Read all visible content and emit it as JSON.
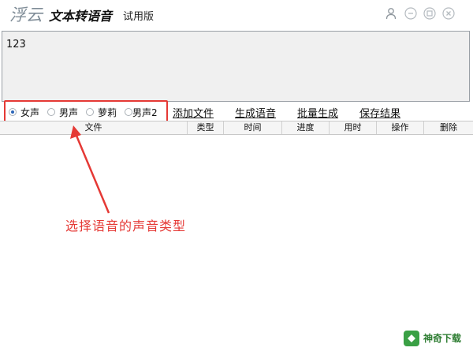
{
  "app": {
    "name": "浮云",
    "subtitle": "文本转语音",
    "edition": "试用版"
  },
  "titlebar": {
    "buttons": [
      {
        "icon": "user-icon"
      },
      {
        "icon": "minimize-icon"
      },
      {
        "icon": "restore-icon"
      },
      {
        "icon": "close-icon"
      }
    ]
  },
  "editor": {
    "text": "123"
  },
  "voice": {
    "options": [
      "女声",
      "男声",
      "萝莉",
      "男声2"
    ],
    "selected": "女声"
  },
  "actions": {
    "add_file": "添加文件",
    "generate": "生成语音",
    "batch": "批量生成",
    "save": "保存结果"
  },
  "table": {
    "headers": [
      "文件",
      "类型",
      "时间",
      "进度",
      "用时",
      "操作",
      "删除"
    ]
  },
  "annotation": {
    "text": "选择语音的声音类型"
  },
  "watermark": {
    "text": "神奇下载"
  },
  "colors": {
    "highlight": "#e53935",
    "text": "#111111",
    "radio_selected": "#2b65b8"
  }
}
